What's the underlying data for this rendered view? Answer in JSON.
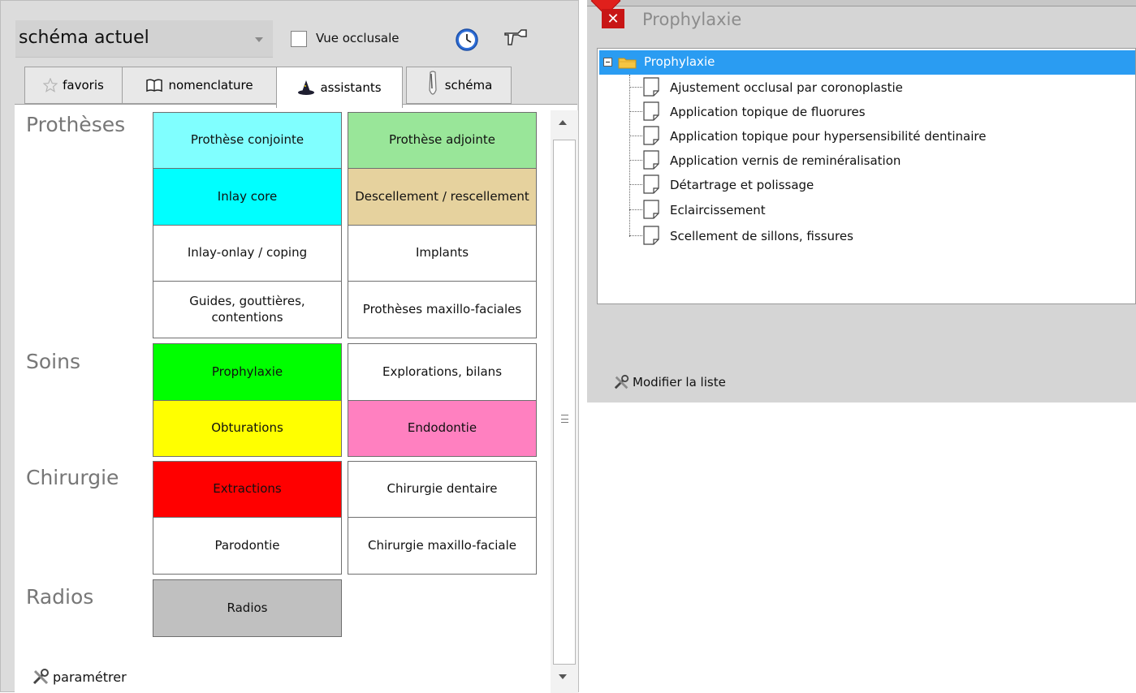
{
  "header": {
    "scheme_select_value": "schéma actuel",
    "occlusal_view_label": "Vue occlusale"
  },
  "tabs": [
    {
      "label": "favoris",
      "icon": "star-icon"
    },
    {
      "label": "nomenclature",
      "icon": "book-icon"
    },
    {
      "label": "assistants",
      "icon": "wizard-hat-icon",
      "active": true
    },
    {
      "label": "schéma",
      "icon": "tooth-icon"
    }
  ],
  "sections": {
    "protheses": "Prothèses",
    "soins": "Soins",
    "chirurgie": "Chirurgie",
    "radios": "Radios"
  },
  "tiles": [
    {
      "label": "Prothèse conjointe",
      "color": "#80ffff"
    },
    {
      "label": "Prothèse adjointe",
      "color": "#99e699"
    },
    {
      "label": "Inlay core",
      "color": "#00ffff"
    },
    {
      "label": "Descellement / rescellement",
      "color": "#e6d29e"
    },
    {
      "label": "Inlay-onlay / coping",
      "color": "#ffffff"
    },
    {
      "label": "Implants",
      "color": "#ffffff"
    },
    {
      "label": "Guides, gouttières, contentions",
      "color": "#ffffff"
    },
    {
      "label": "Prothèses maxillo-faciales",
      "color": "#ffffff"
    },
    {
      "label": "Prophylaxie",
      "color": "#00ff00"
    },
    {
      "label": "Explorations, bilans",
      "color": "#ffffff"
    },
    {
      "label": "Obturations",
      "color": "#ffff00"
    },
    {
      "label": "Endodontie",
      "color": "#ff80c0"
    },
    {
      "label": "Extractions",
      "color": "#ff0000"
    },
    {
      "label": "Chirurgie dentaire",
      "color": "#ffffff"
    },
    {
      "label": "Parodontie",
      "color": "#ffffff"
    },
    {
      "label": "Chirurgie maxillo-faciale",
      "color": "#ffffff"
    },
    {
      "label": "Radios",
      "color": "#c0c0c0"
    }
  ],
  "footer_left": {
    "configure_label": "paramétrer"
  },
  "right_panel": {
    "title": "Prophylaxie",
    "tree_root": "Prophylaxie",
    "items": [
      "Ajustement occlusal par coronoplastie",
      "Application topique de fluorures",
      "Application topique pour hypersensibilité dentinaire",
      "Application vernis de reminéralisation",
      "Détartrage et polissage",
      "Eclaircissement",
      "Scellement de sillons, fissures"
    ],
    "modify_list_label": "Modifier la liste"
  },
  "colors": {
    "selection_blue": "#2a9cf2",
    "close_red": "#c81515"
  }
}
